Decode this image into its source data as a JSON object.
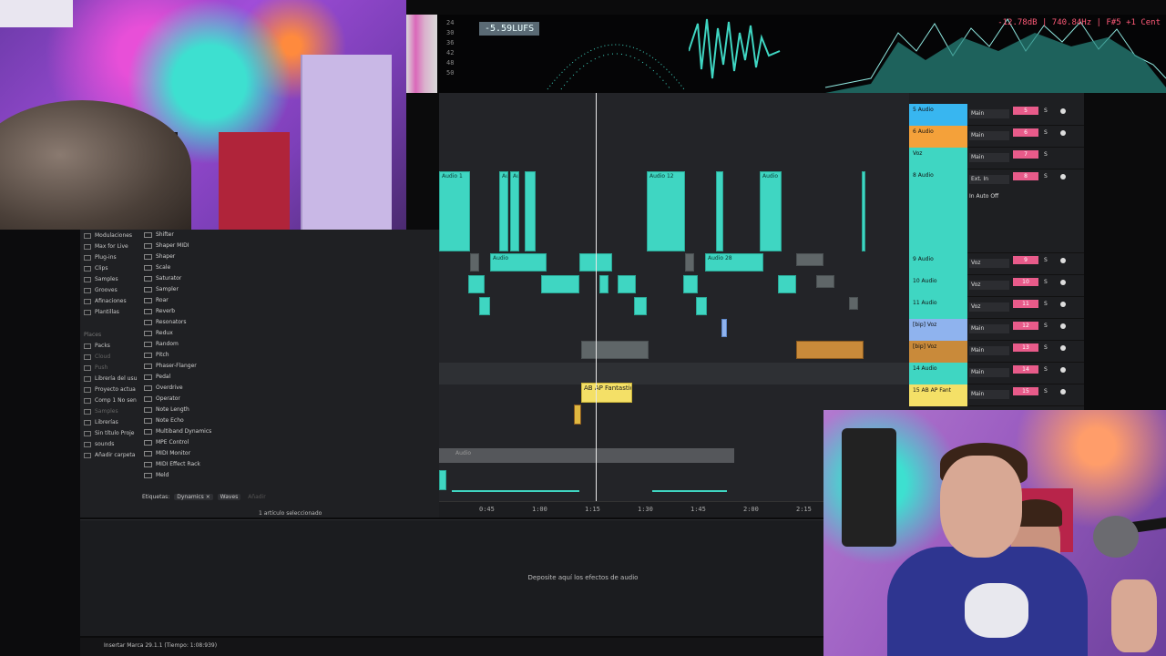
{
  "topbar": {
    "lufs": "-5.59LUFS",
    "scale": [
      "24",
      "30",
      "36",
      "42",
      "48",
      "50"
    ],
    "readout": "-12.78dB | 740.84Hz | F#5 +1  Cent"
  },
  "browser": {
    "categories": [
      "Modulaciones",
      "Max for Live",
      "Plug-ins",
      "Clips",
      "Samples",
      "Grooves",
      "Afinaciones",
      "Plantillas"
    ],
    "places_label": "Places",
    "places": [
      "Packs",
      "Cloud",
      "Push",
      "Librería del usu",
      "Proyecto actua",
      "Comp 1 No sen",
      "Samples",
      "Librerías",
      "Sin título Proje",
      "sounds",
      "Añadir carpeta"
    ],
    "devices": [
      "Shifter",
      "Shaper MIDI",
      "Shaper",
      "Scale",
      "Saturator",
      "Sampler",
      "Roar",
      "Reverb",
      "Resonators",
      "Redux",
      "Random",
      "Pitch",
      "Phaser-Flanger",
      "Pedal",
      "Overdrive",
      "Operator",
      "Note Length",
      "Note Echo",
      "Multiband Dynamics",
      "MPE Control",
      "MIDI Monitor",
      "MIDI Effect Rack",
      "Meld"
    ],
    "tags_label": "Etiquetas:",
    "tags": [
      "Dynamics ×",
      "Waves"
    ],
    "tags_add": "Añadir",
    "selection": "1 artículo seleccionado"
  },
  "arrangement": {
    "clips_top": [
      "Audio 1",
      "Au",
      "Au",
      "Audio 12",
      "Audio"
    ],
    "clips_row2": [
      "Audio",
      "Audio 28"
    ],
    "yellow_clip": "AB AP Fantastic",
    "audio_row": "Audio",
    "ruler_ticks": [
      "0:45",
      "1:00",
      "1:15",
      "1:30",
      "1:45",
      "2:00",
      "2:15"
    ]
  },
  "mixer": {
    "tracks": [
      {
        "name": "5 Audio",
        "out": "Main",
        "num": "5",
        "color": "#38b6f0"
      },
      {
        "name": "6 Audio",
        "out": "Main",
        "num": "6",
        "color": "#f4a13a"
      },
      {
        "name": "Voz",
        "out": "Main",
        "num": "7",
        "color": "#3fd6c2"
      },
      {
        "name": "8 Audio",
        "out": "Ext. In",
        "num": "8",
        "color": "#3fd6c2"
      },
      {
        "name": "9 Audio",
        "out": "Voz",
        "num": "9",
        "color": "#3fd6c2"
      },
      {
        "name": "10 Audio",
        "out": "Voz",
        "num": "10",
        "color": "#3fd6c2"
      },
      {
        "name": "11 Audio",
        "out": "Voz",
        "num": "11",
        "color": "#3fd6c2"
      },
      {
        "name": "[bip] Voz",
        "out": "Main",
        "num": "12",
        "color": "#8fb3ee"
      },
      {
        "name": "[bip] Voz",
        "out": "Main",
        "num": "13",
        "color": "#c98a3a"
      },
      {
        "name": "14 Audio",
        "out": "Main",
        "num": "14",
        "color": "#3fd6c2"
      },
      {
        "name": "15 AB AP Fant",
        "out": "Main",
        "num": "15",
        "color": "#f4e067"
      }
    ],
    "solo": "S",
    "input_auto": "In  Auto  Off"
  },
  "device_area": {
    "drop_hint": "Deposite aquí los efectos de audio"
  },
  "status": {
    "text": "Insertar Marca 29.1.1 (Tiempo: 1:08:939)"
  },
  "colors": {
    "accent": "#3fd6c2",
    "record": "#e85b8a"
  }
}
